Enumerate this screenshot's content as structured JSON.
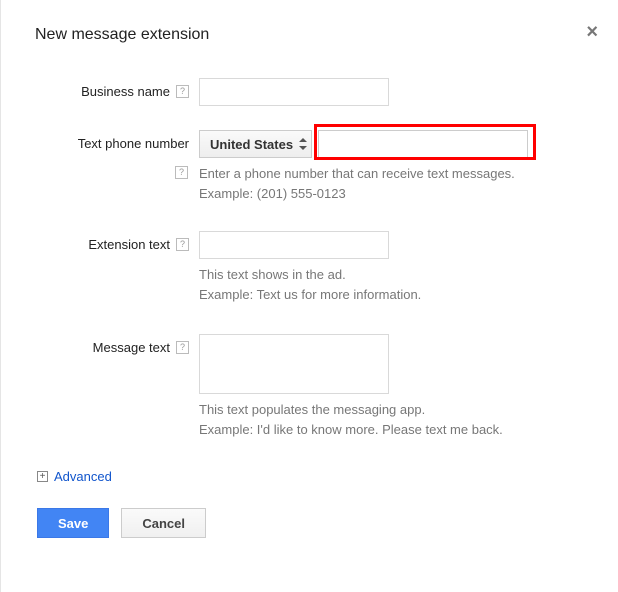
{
  "dialog": {
    "title": "New message extension"
  },
  "form": {
    "business_name": {
      "label": "Business name",
      "value": ""
    },
    "phone": {
      "label": "Text phone number",
      "country_selected": "United States",
      "value": "",
      "hint": "Enter a phone number that can receive text messages.",
      "example": "Example: (201) 555-0123"
    },
    "extension_text": {
      "label": "Extension text",
      "value": "",
      "hint": "This text shows in the ad.",
      "example": "Example: Text us for more information."
    },
    "message_text": {
      "label": "Message text",
      "value": "",
      "hint": "This text populates the messaging app.",
      "example": "Example: I'd like to know more. Please text me back."
    }
  },
  "advanced": {
    "label": "Advanced"
  },
  "buttons": {
    "save": "Save",
    "cancel": "Cancel"
  }
}
